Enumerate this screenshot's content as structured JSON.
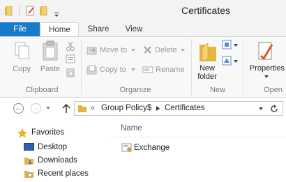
{
  "window": {
    "title": "Certificates"
  },
  "tabs": [
    "File",
    "Home",
    "Share",
    "View"
  ],
  "ribbon": {
    "clipboard": {
      "copy": "Copy",
      "paste": "Paste",
      "group": "Clipboard"
    },
    "organize": {
      "move_to": "Move to",
      "copy_to": "Copy to",
      "delete": "Delete",
      "rename": "Rename",
      "group": "Organize"
    },
    "new": {
      "new_folder_line1": "New",
      "new_folder_line2": "folder",
      "group": "New"
    },
    "open": {
      "properties": "Properties",
      "group": "Open"
    }
  },
  "address": {
    "prefix": "«",
    "segments": [
      "Group Policy$",
      "Certificates"
    ]
  },
  "nav": {
    "favorites": "Favorites",
    "items": [
      "Desktop",
      "Downloads",
      "Recent places"
    ]
  },
  "content": {
    "column_name": "Name",
    "files": [
      "Exchange"
    ]
  },
  "colors": {
    "file_tab": "#1979ca",
    "folder": "#e8b84a"
  }
}
